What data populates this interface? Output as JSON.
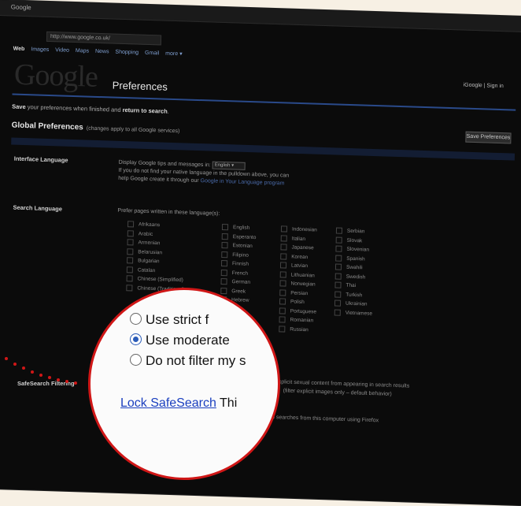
{
  "browser": {
    "tab_title": "Google",
    "address": "http://www.google.co.uk/"
  },
  "nav": {
    "items": [
      "Web",
      "Images",
      "Video",
      "Maps",
      "News",
      "Shopping",
      "Gmail",
      "more ▾"
    ],
    "signin": "iGoogle | Sign in"
  },
  "header": {
    "logo": "Google",
    "title": "Preferences"
  },
  "save_line": {
    "prefix": "Save",
    "middle": " your preferences when finished and ",
    "bold": "return to search",
    "suffix": "."
  },
  "global": {
    "title": "Global Preferences",
    "note": "(changes apply to all Google services)",
    "save_button": "Save Preferences"
  },
  "interface_language": {
    "label": "Interface Language",
    "line1_prefix": "Display Google tips and messages in:",
    "selected": "English",
    "line2": "If you do not find your native language in the pulldown above, you can",
    "line3_prefix": "help Google create it through our",
    "line3_link": "Google in Your Language program"
  },
  "search_language": {
    "label": "Search Language",
    "intro": "Prefer pages written in these language(s):",
    "columns": [
      [
        "Afrikaans",
        "Arabic",
        "Armenian",
        "Belarusian",
        "Bulgarian",
        "Catalan",
        "Chinese (Simplified)",
        "Chinese (Traditional)"
      ],
      [
        "English",
        "Esperanto",
        "Estonian",
        "Filipino",
        "Finnish",
        "French",
        "German",
        "Greek",
        "Hebrew"
      ],
      [
        "Indonesian",
        "Italian",
        "Japanese",
        "Korean",
        "Latvian",
        "Lithuanian",
        "Norwegian",
        "Persian",
        "Polish",
        "Portuguese",
        "Romanian",
        "Russian"
      ],
      [
        "Serbian",
        "Slovak",
        "Slovenian",
        "Spanish",
        "Swahili",
        "Swedish",
        "Thai",
        "Turkish",
        "Ukrainian",
        "Vietnamese"
      ]
    ]
  },
  "safesearch": {
    "label": "SafeSearch Filtering",
    "options": [
      {
        "text": "Use strict filtering",
        "selected": false
      },
      {
        "text": "Use moderate filtering",
        "selected": true
      },
      {
        "text": "Do not filter my search results",
        "selected": false
      }
    ],
    "lock_link": "Lock SafeSearch",
    "lock_suffix": "This",
    "desc1": "explicit sexual content from appearing in search results",
    "desc2": "(filter explicit images only – default behavior)",
    "desc3": "applies to searches from this computer using Firefox"
  },
  "magnifier": {
    "options": [
      "Use strict f",
      "Use moderate",
      "Do not filter my s"
    ],
    "lock_link": "Lock SafeSearch",
    "lock_suffix": "Thi"
  },
  "colors": {
    "accent_red": "#d01717",
    "link_blue": "#1a3fbf",
    "accent_orange": "#e0a84a"
  }
}
